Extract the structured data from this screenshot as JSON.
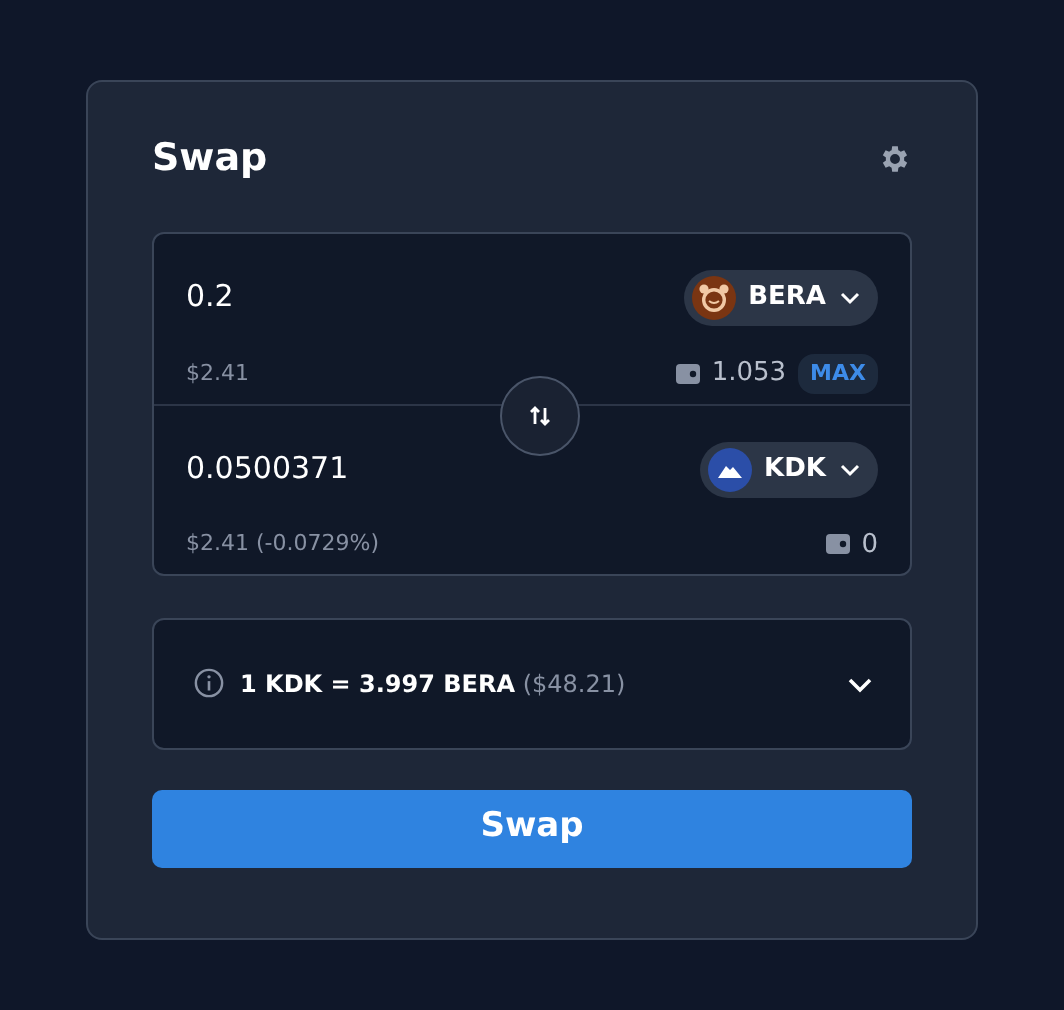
{
  "title": "Swap",
  "tokens": [
    {
      "amount": "0.2",
      "symbol": "BERA",
      "kind": "bear",
      "usd": "$2.41",
      "balance": "1.053",
      "max": "MAX"
    },
    {
      "amount": "0.0500371",
      "symbol": "KDK",
      "kind": "mountain",
      "usd": "$2.41 (-0.0729%)",
      "balance": "0"
    }
  ],
  "rate": {
    "text": "1 KDK = 3.997 BERA",
    "usd": "($48.21)",
    "expanded": false
  },
  "button": "Swap"
}
